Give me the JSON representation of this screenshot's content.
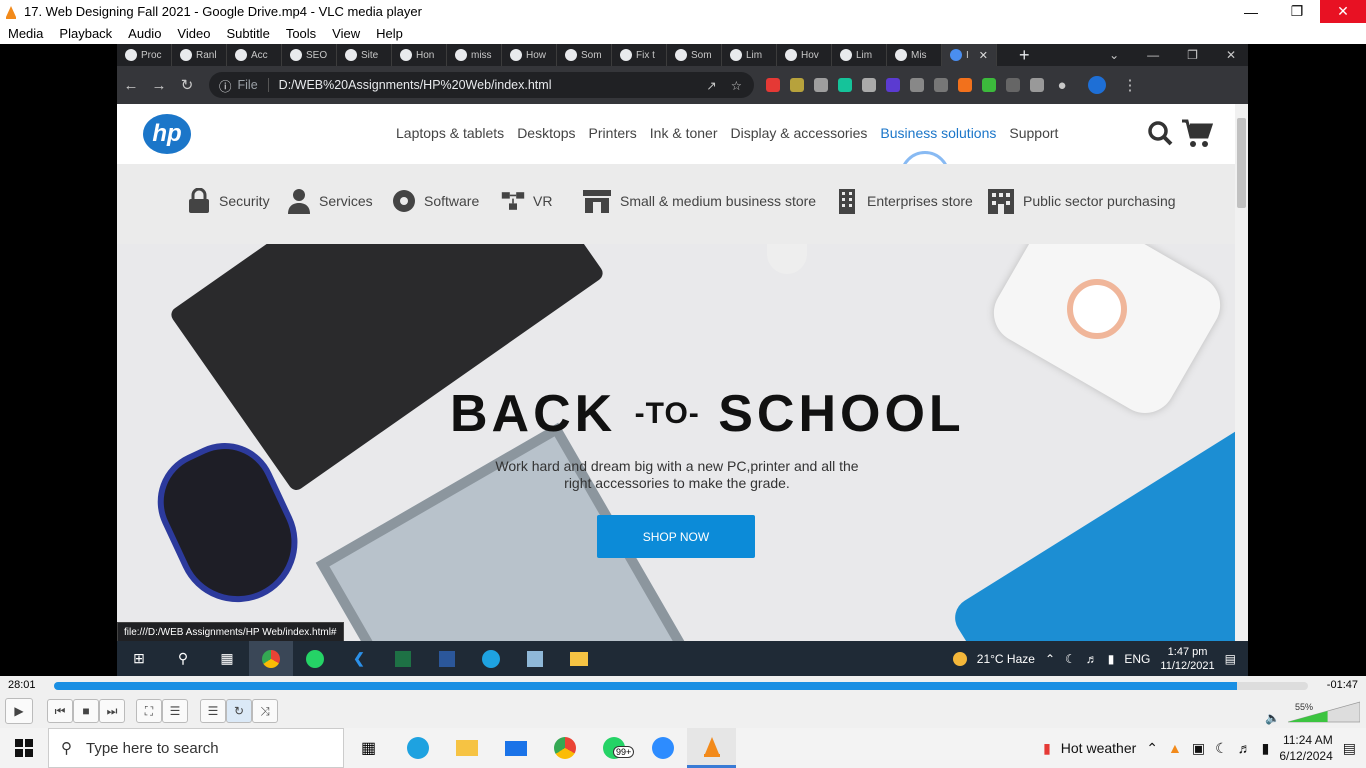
{
  "vlc": {
    "title": "17. Web Designing Fall 2021 - Google Drive.mp4 - VLC media player",
    "menu": [
      "Media",
      "Playback",
      "Audio",
      "Video",
      "Subtitle",
      "Tools",
      "View",
      "Help"
    ],
    "time_elapsed": "28:01",
    "time_remaining": "-01:47",
    "progress": 0.943,
    "volume_label": "55%",
    "volume": 0.55
  },
  "browser": {
    "tabs": [
      "Proc",
      "Ranl",
      "Acc",
      "SEO",
      "Site",
      "Hon",
      "miss",
      "How",
      "Som",
      "Fix t",
      "Som",
      "Lim",
      "Hov",
      "Lim",
      "Mis",
      "I"
    ],
    "address_file_label": "File",
    "address": "D:/WEB%20Assignments/HP%20Web/index.html",
    "status_url": "file:///D:/WEB Assignments/HP Web/index.html#"
  },
  "site": {
    "logo": "hp",
    "nav": [
      "Laptops & tablets",
      "Desktops",
      "Printers",
      "Ink & toner",
      "Display & accessories",
      "Business solutions",
      "Support"
    ],
    "subnav": [
      "Security",
      "Services",
      "Software",
      "VR",
      "Small & medium business store",
      "Enterprises store",
      "Public sector purchasing"
    ],
    "hero_title_a": "BACK",
    "hero_title_to": "-TO-",
    "hero_title_b": "SCHOOL",
    "hero_sub": "Work hard and dream big with a new PC,printer and all the right accessories to make the grade.",
    "cta": "SHOP NOW"
  },
  "inner_taskbar": {
    "weather": "21°C  Haze",
    "lang": "ENG",
    "time": "1:47 pm",
    "date": "11/12/2021"
  },
  "host_taskbar": {
    "search_placeholder": "Type here to search",
    "weather": "Hot weather",
    "time": "11:24 AM",
    "date": "6/12/2024",
    "whatsapp_badge": "99+"
  },
  "colors": {
    "accent": "#1b76c9",
    "cta": "#0c8bd8",
    "vlc_seek": "#1a8fe3",
    "close_red": "#e81123"
  }
}
